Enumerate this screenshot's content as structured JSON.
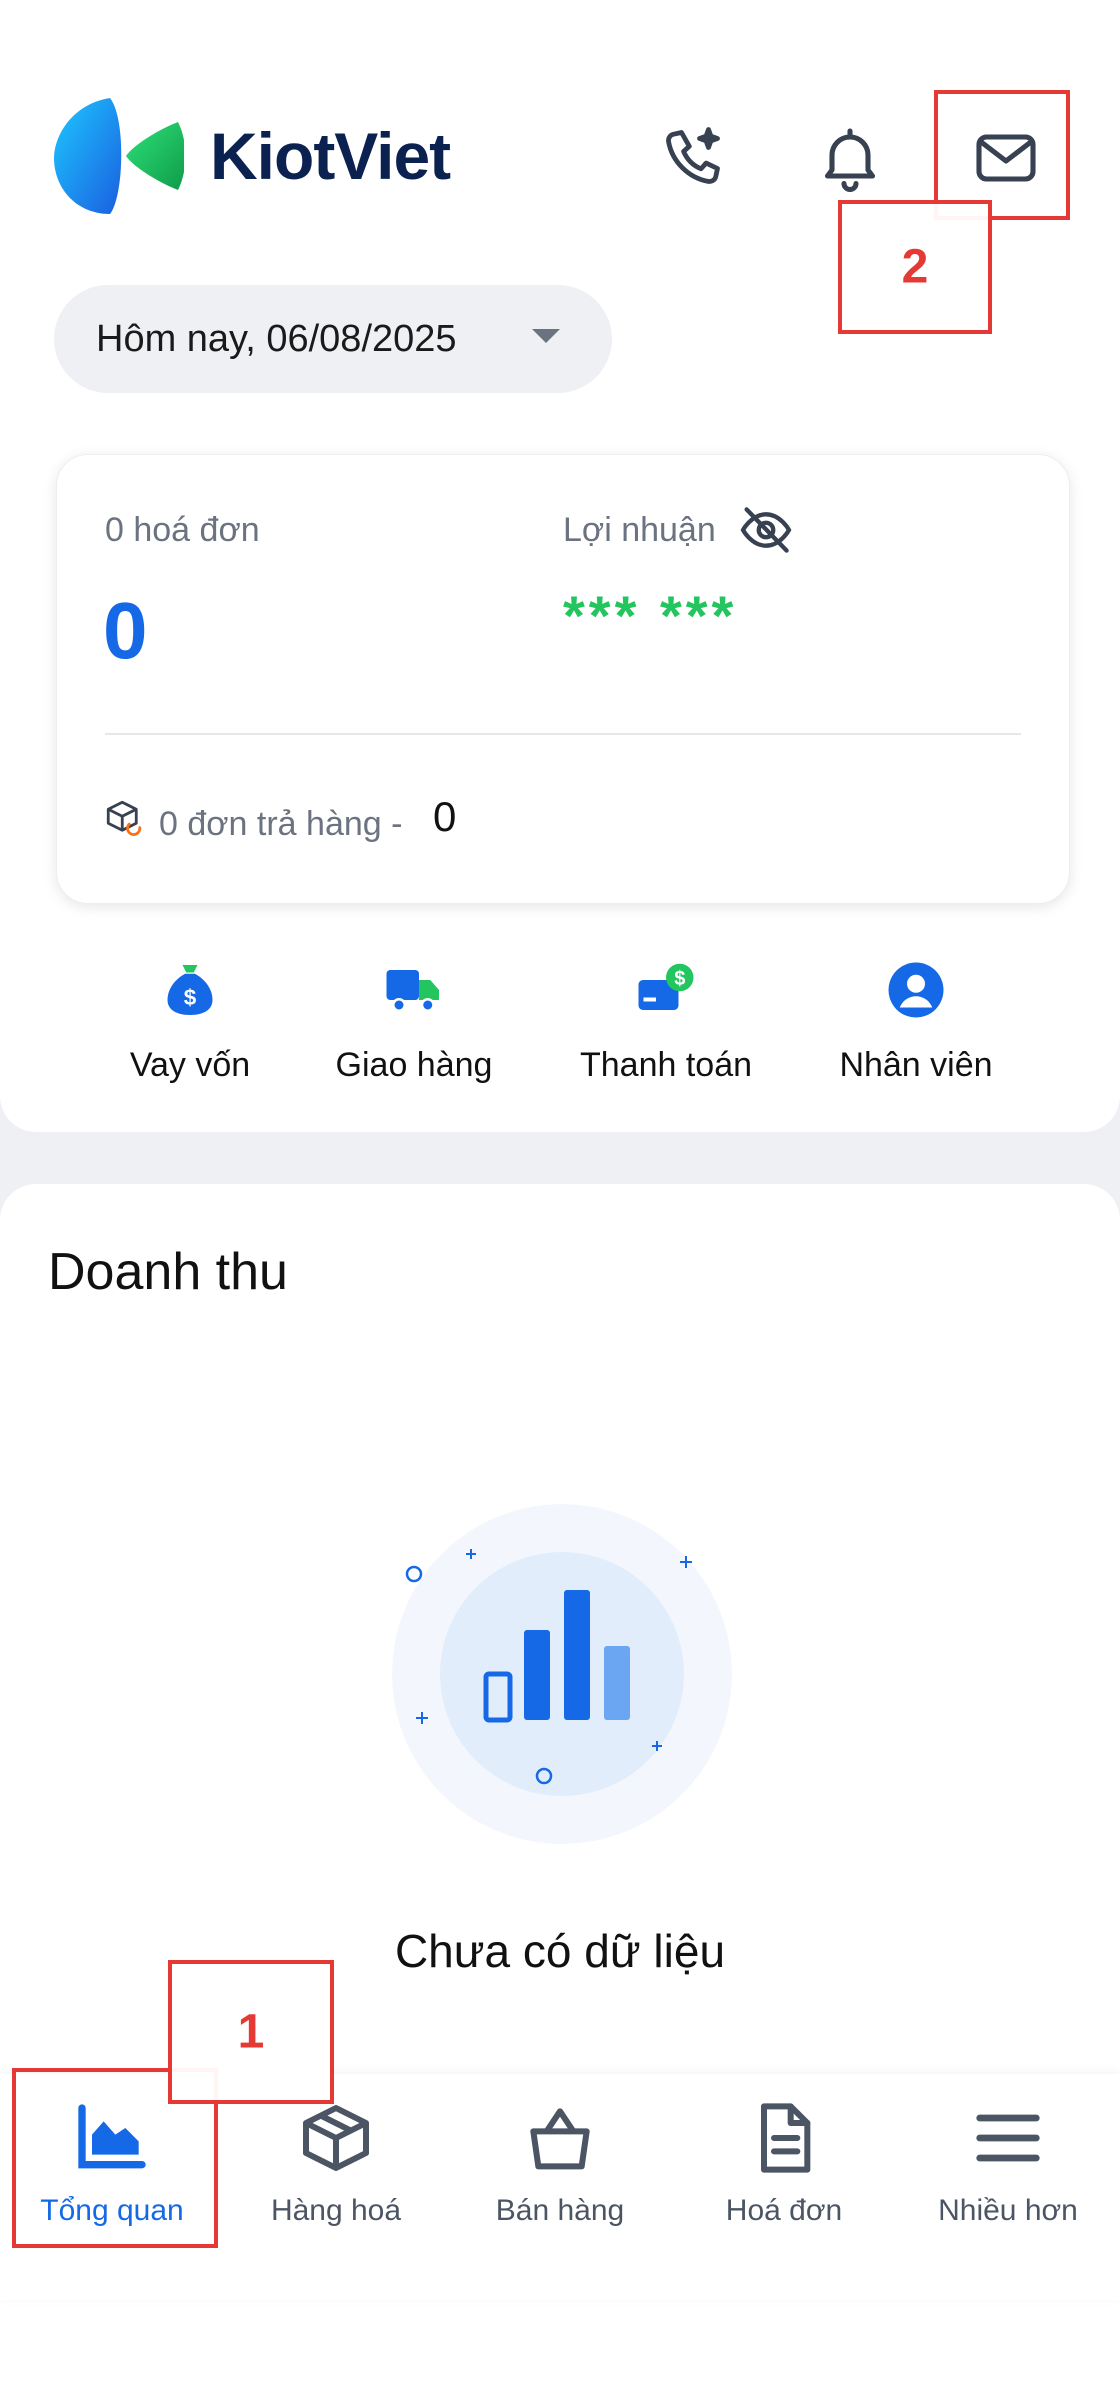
{
  "brand": {
    "name": "KiotViet"
  },
  "header": {
    "icons": [
      "phone-sparkle-icon",
      "bell-icon",
      "mail-icon"
    ]
  },
  "date_filter": {
    "label": "Hôm nay, 06/08/2025"
  },
  "stats": {
    "invoices_label": "0 hoá đơn",
    "invoices_value": "0",
    "profit_label": "Lợi nhuận",
    "profit_value": "*** ***",
    "returns_label": "0 đơn trả hàng -",
    "returns_value": "0"
  },
  "shortcuts": [
    {
      "label": "Vay vốn",
      "icon": "money-bag-icon"
    },
    {
      "label": "Giao hàng",
      "icon": "delivery-truck-icon"
    },
    {
      "label": "Thanh toán",
      "icon": "payment-card-icon"
    },
    {
      "label": "Nhân viên",
      "icon": "employee-icon"
    }
  ],
  "revenue": {
    "title": "Doanh thu",
    "empty_text": "Chưa có dữ liệu"
  },
  "bottom_nav": [
    {
      "label": "Tổng quan",
      "icon": "chart-area-icon",
      "active": true
    },
    {
      "label": "Hàng hoá",
      "icon": "box-icon",
      "active": false
    },
    {
      "label": "Bán hàng",
      "icon": "shopping-bag-icon",
      "active": false
    },
    {
      "label": "Hoá đơn",
      "icon": "document-icon",
      "active": false
    },
    {
      "label": "Nhiều hơn",
      "icon": "menu-icon",
      "active": false
    }
  ],
  "annotations": [
    {
      "number": "1"
    },
    {
      "number": "2"
    }
  ],
  "colors": {
    "accent": "#1569e6",
    "profit": "#22c55e",
    "annotation": "#e53935",
    "brand_text": "#0b2250"
  }
}
